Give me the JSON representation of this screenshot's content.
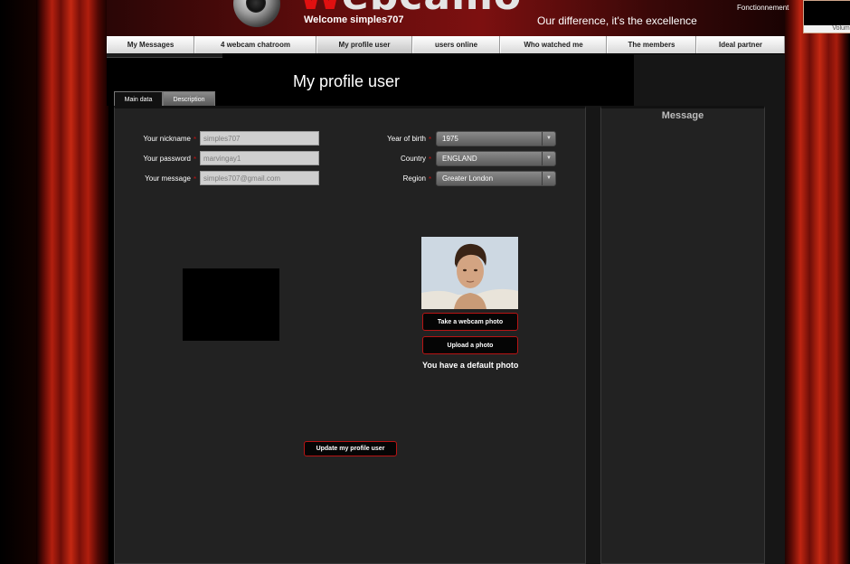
{
  "header": {
    "logo_text_first": "W",
    "logo_text_rest": "ebcamo",
    "welcome": "Welcome simples707",
    "tagline": "Our difference, it's the excellence",
    "status": "Fonctionnement",
    "volume_label": "Volume"
  },
  "nav": {
    "tabs": [
      {
        "label": "My Messages"
      },
      {
        "label": "4 webcam chatroom"
      },
      {
        "label": "My profile user"
      },
      {
        "label": "users online"
      },
      {
        "label": "Who watched me"
      },
      {
        "label": "The members"
      },
      {
        "label": "Ideal partner"
      }
    ],
    "active": "My profile user"
  },
  "page": {
    "title": "My profile user",
    "tabs": {
      "main": "Main data",
      "description": "Description"
    }
  },
  "form": {
    "nickname_label": "Your nickname",
    "nickname_value": "simples707",
    "password_label": "Your password",
    "password_value": "marvingay1",
    "message_label": "Your message",
    "message_value": "simples707@gmail.com",
    "required_mark": "*",
    "birth_label": "Year of birth",
    "birth_value": "1975",
    "country_label": "Country",
    "country_value": "ENGLAND",
    "region_label": "Region",
    "region_value": "Greater London"
  },
  "photo": {
    "take_webcam_label": "Take a webcam photo",
    "upload_label": "Upload a photo",
    "status": "You have a default photo"
  },
  "actions": {
    "update_label": "Update my profile user"
  },
  "sidebar": {
    "title": "Message"
  },
  "colors": {
    "accent": "#c41212",
    "curtain": "#b3200f",
    "panel": "#222222"
  }
}
